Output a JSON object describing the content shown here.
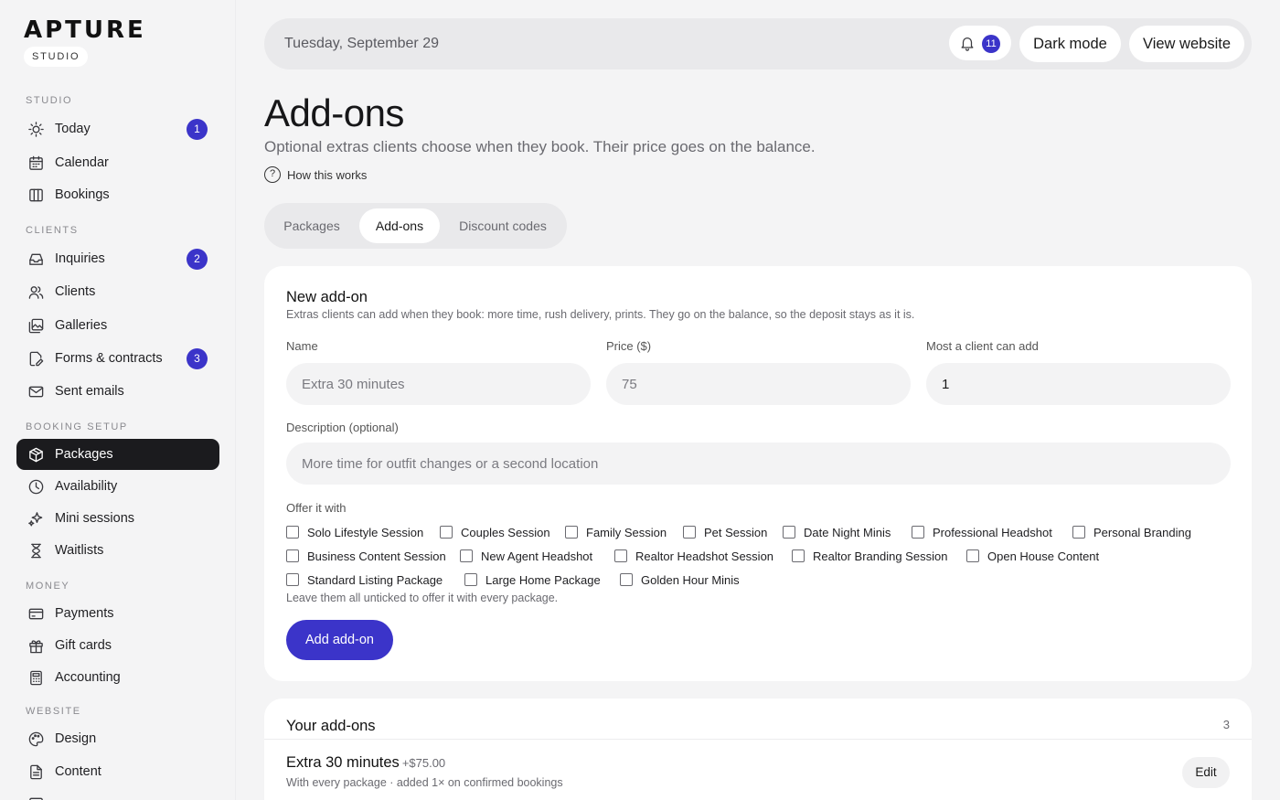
{
  "sidebar": {
    "logo_text": "APTURE",
    "studio_label": "STUDIO",
    "sections": {
      "studio": "STUDIO",
      "clients": "CLIENTS",
      "booking_setup": "BOOKING SETUP",
      "money": "MONEY",
      "website": "WEBSITE"
    },
    "items": [
      {
        "label": "Today",
        "icon": "sun-icon",
        "badge": "1"
      },
      {
        "label": "Calendar",
        "icon": "calendar-icon"
      },
      {
        "label": "Bookings",
        "icon": "columns-icon"
      },
      {
        "label": "Inquiries",
        "icon": "inbox-icon",
        "badge": "2"
      },
      {
        "label": "Clients",
        "icon": "users-icon"
      },
      {
        "label": "Galleries",
        "icon": "gallery-icon"
      },
      {
        "label": "Forms & contracts",
        "icon": "document-edit-icon",
        "badge": "3"
      },
      {
        "label": "Sent emails",
        "icon": "mail-icon"
      },
      {
        "label": "Packages",
        "icon": "package-icon",
        "active": true
      },
      {
        "label": "Availability",
        "icon": "clock-icon"
      },
      {
        "label": "Mini sessions",
        "icon": "sparkle-icon"
      },
      {
        "label": "Waitlists",
        "icon": "hourglass-icon"
      },
      {
        "label": "Payments",
        "icon": "card-icon"
      },
      {
        "label": "Gift cards",
        "icon": "gift-icon"
      },
      {
        "label": "Accounting",
        "icon": "calculator-icon"
      },
      {
        "label": "Design",
        "icon": "palette-icon"
      },
      {
        "label": "Content",
        "icon": "document-icon"
      }
    ]
  },
  "topbar": {
    "date": "Tuesday, September 29",
    "notification_count": "11",
    "dark_mode_label": "Dark mode",
    "view_website_label": "View website"
  },
  "header": {
    "title": "Add-ons",
    "subtitle": "Optional extras clients choose when they book. Their price goes on the balance.",
    "how_link": "How this works",
    "how_icon": "?"
  },
  "tabs": [
    "Packages",
    "Add-ons",
    "Discount codes"
  ],
  "new_addon": {
    "title": "New add-on",
    "description": "Extras clients can add when they book: more time, rush delivery, prints. They go on the balance, so the deposit stays as it is.",
    "name_label": "Name",
    "name_placeholder": "Extra 30 minutes",
    "price_label": "Price ($)",
    "price_placeholder": "75",
    "max_label": "Most a client can add",
    "max_value": "1",
    "desc_label": "Description (optional)",
    "desc_placeholder": "More time for outfit changes or a second location",
    "offer_label": "Offer it with",
    "packages": [
      "Solo Lifestyle Session",
      "Couples Session",
      "Family Session",
      "Pet Session",
      "Date Night Minis",
      "Professional Headshot",
      "Personal Branding",
      "Business Content Session",
      "New Agent Headshot",
      "Realtor Headshot Session",
      "Realtor Branding Session",
      "Open House Content",
      "Standard Listing Package",
      "Large Home Package",
      "Golden Hour Minis"
    ],
    "hint": "Leave them all unticked to offer it with every package.",
    "submit_label": "Add add-on"
  },
  "your_addons": {
    "title": "Your add-ons",
    "count": "3",
    "items": [
      {
        "name": "Extra 30 minutes",
        "price": "+$75.00",
        "meta": "With every package · added 1× on confirmed bookings",
        "edit_label": "Edit"
      }
    ]
  },
  "colors": {
    "accent": "#3b34c9",
    "active_nav": "#1b1b1e"
  }
}
